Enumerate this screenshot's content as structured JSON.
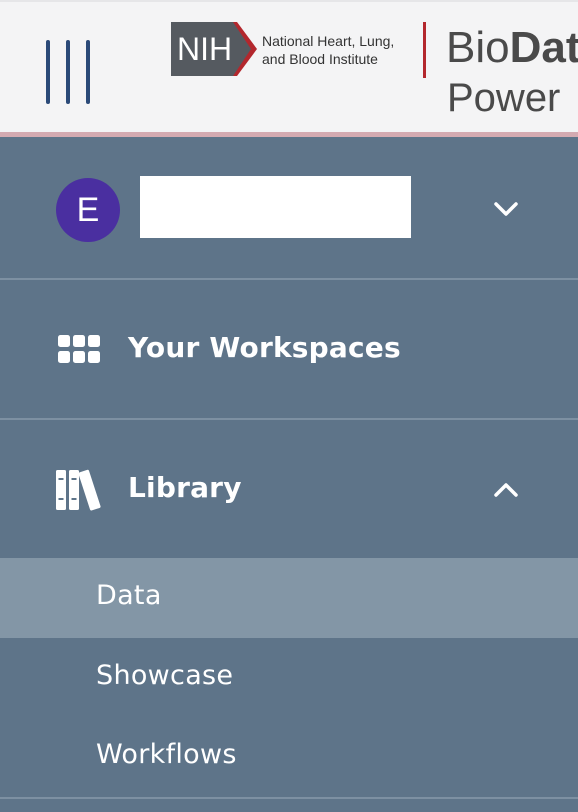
{
  "header": {
    "nih_badge": "NIH",
    "nih_line1": "National Heart, Lung,",
    "nih_line2": "and Blood Institute",
    "brand_line1_regular": "Bio",
    "brand_line1_bold": "Dat",
    "brand_line2": "Power"
  },
  "user": {
    "avatar_initial": "E",
    "avatar_color": "#4a2fa0"
  },
  "menu": {
    "workspaces_label": "Your Workspaces",
    "library_label": "Library",
    "library_sub": {
      "data": "Data",
      "showcase": "Showcase",
      "workflows": "Workflows"
    }
  },
  "colors": {
    "sidebar_bg": "#5e7489",
    "active_bg": "#8396a6",
    "hamburger": "#2b4a78",
    "nih_red": "#b3272d"
  }
}
